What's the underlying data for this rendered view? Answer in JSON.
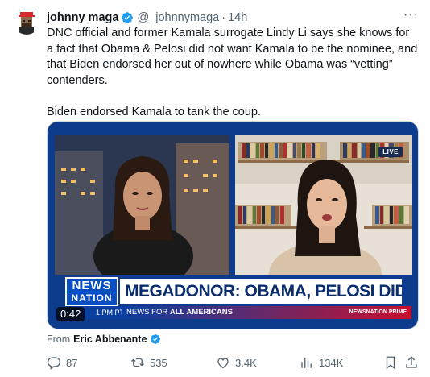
{
  "author": {
    "name": "johnny maga",
    "handle": "@_johnnymaga",
    "separator": "·",
    "time": "14h"
  },
  "more_label": "···",
  "tweet": {
    "paragraph1": "DNC official and former Kamala surrogate Lindy Li says she knows for a fact that Obama & Pelosi did not want Kamala to be the nominee, and that Biden endorsed her out of nowhere while Obama was “vetting” contenders.",
    "paragraph2": "Biden endorsed Kamala to tank the coup."
  },
  "video": {
    "live_badge": "LIVE",
    "logo_line1": "NEWS",
    "logo_line2": "NATION",
    "headline": "MEGADONOR: OBAMA, PELOSI DIDN'T WANT HARRIS",
    "clock": "1 PM PT",
    "ticker_prefix": "NEWS FOR ",
    "ticker_bold": "ALL AMERICANS",
    "ticker_brand": "NEWSNATION PRIME",
    "duration": "0:42"
  },
  "from": {
    "label": "From",
    "source": "Eric Abbenante"
  },
  "actions": {
    "replies": "87",
    "reposts": "535",
    "likes": "3.4K",
    "views": "134K"
  },
  "colors": {
    "verified": "#1d9bf0",
    "muted": "#536471",
    "text": "#0f1419",
    "newsnation_blue": "#0a4fc1"
  },
  "icons": [
    "verified-icon",
    "more-icon",
    "reply-icon",
    "repost-icon",
    "like-icon",
    "views-icon",
    "bookmark-icon",
    "share-icon"
  ]
}
